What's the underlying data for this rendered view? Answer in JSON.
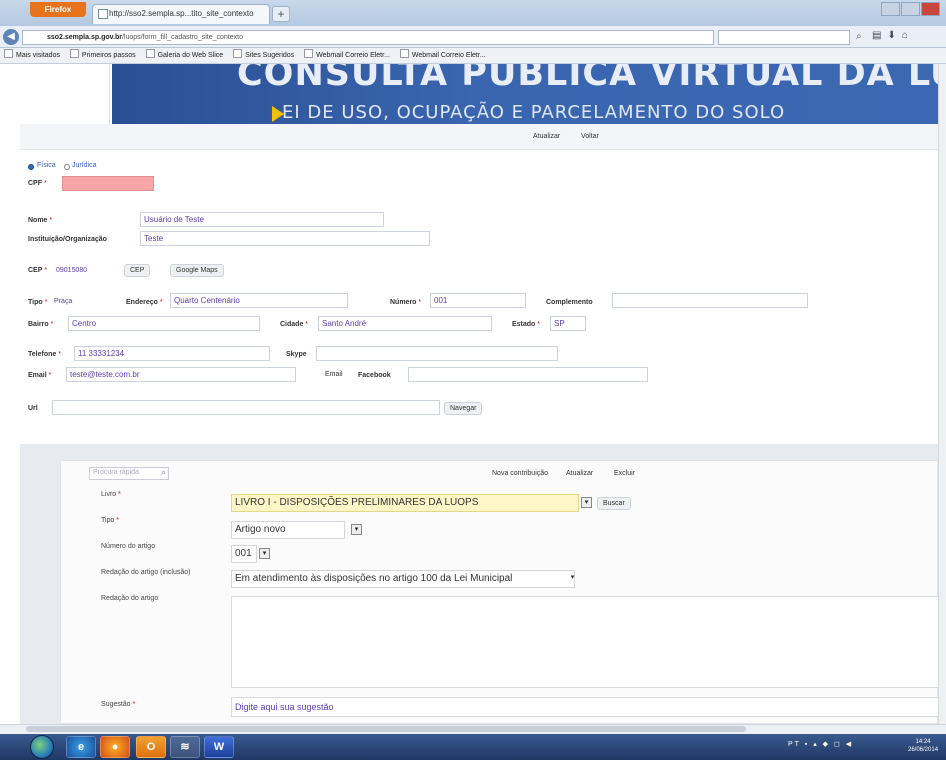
{
  "browser": {
    "firefox_button": "Firefox",
    "tab_title": "http://sso2.sempla.sp...tito_site_contexto",
    "url_host": "sso2.sempla.sp.gov.br",
    "url_path": "/luops/form_fill_cadastro_site_contexto",
    "bookmarks": [
      "Mais visitados",
      "Primeiros passos",
      "Galeria do Web Slice",
      "Sites Sugeridos",
      "Webmail Correio Eletr...",
      "Webmail Correio Eletr..."
    ]
  },
  "banner": {
    "title": "CONSULTA PÚBLICA VIRTUAL DA LUOPS",
    "subtitle": "EI DE USO, OCUPAÇÃO E PARCELAMENTO DO SOLO",
    "atualizar": "Atualizar",
    "voltar": "Voltar"
  },
  "person": {
    "radio_fisica": "Física",
    "radio_juridica": "Jurídica",
    "cpf_label": "CPF"
  },
  "form": {
    "nome_label": "Nome",
    "nome_value": "Usuário de Teste",
    "instituicao_label": "Instituição/Organização",
    "instituicao_value": "Teste",
    "cep_label": "CEP",
    "cep_value": "09015080",
    "cep_btn": "CEP",
    "google_maps_btn": "Google Maps",
    "tipo_label": "Tipo",
    "tipo_value": "Praça",
    "endereco_label": "Endereço",
    "endereco_value": "Quarto Centenário",
    "numero_label": "Número",
    "numero_value": "001",
    "complemento_label": "Complemento",
    "bairro_label": "Bairro",
    "bairro_value": "Centro",
    "cidade_label": "Cidade",
    "cidade_value": "Santo André",
    "estado_label": "Estado",
    "estado_value": "SP",
    "telefone_label": "Telefone",
    "telefone_value": "11 33331234",
    "skype_label": "Skype",
    "email_label": "Email",
    "email_value": "teste@teste.com.br",
    "email_btn": "Email",
    "facebook_label": "Facebook",
    "url_label": "Url",
    "navegar_btn": "Navegar"
  },
  "contribution": {
    "search_placeholder": "Procura rápida",
    "nova_btn": "Nova contribuição",
    "atualizar_btn": "Atualizar",
    "excluir_btn": "Excluir",
    "livro_label": "Livro",
    "livro_value": "LIVRO I - DISPOSIÇÕES PRELIMINARES DA LUOPS",
    "buscar_btn": "Buscar",
    "tipo_label": "Tipo",
    "tipo_value": "Artigo novo",
    "numero_label": "Número do artigo",
    "numero_value": "001",
    "redacao_inclusao_label": "Redação do artigo (inclusão)",
    "redacao_inclusao_value": "Em atendimento às disposições no artigo 100 da Lei Municipal",
    "redacao_label": "Redação do artigo",
    "sugestao_label": "Sugestão",
    "sugestao_value": "Digite aqui sua sugestão"
  },
  "taskbar": {
    "tray": "PT",
    "time": "14:24",
    "date": "26/06/2014"
  },
  "colors": {
    "banner": "#2b4f93",
    "value_text": "#5a3fb0",
    "cpf_highlight": "#f6a6a6",
    "livro_highlight": "#fff6c8"
  }
}
